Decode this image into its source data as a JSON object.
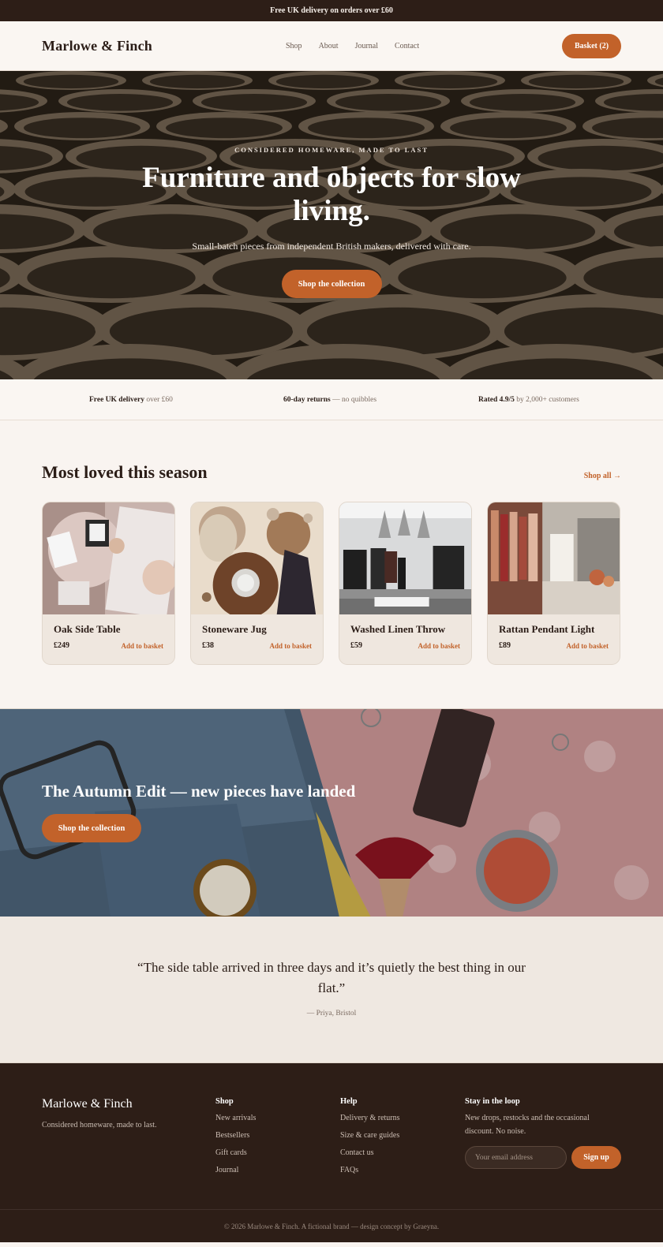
{
  "announcement": "Free UK delivery on orders over £60",
  "header": {
    "logo": "Marlowe & Finch",
    "nav": [
      "Shop",
      "About",
      "Journal",
      "Contact"
    ],
    "basket": "Basket (2)"
  },
  "hero": {
    "eyebrow": "CONSIDERED HOMEWARE, MADE TO LAST",
    "title": "Furniture and objects for slow living.",
    "subtitle": "Small-batch pieces from independent British makers, delivered with care.",
    "cta": "Shop the collection"
  },
  "trust": [
    {
      "bold": "Free UK delivery",
      "rest": " over £60"
    },
    {
      "bold": "60-day returns",
      "rest": " — no quibbles"
    },
    {
      "bold": "Rated 4.9/5",
      "rest": " by 2,000+ customers"
    }
  ],
  "products": {
    "title": "Most loved this season",
    "shop_all": "Shop all →",
    "items": [
      {
        "name": "Oak Side Table",
        "price": "£249",
        "cta": "Add to basket"
      },
      {
        "name": "Stoneware Jug",
        "price": "£38",
        "cta": "Add to basket"
      },
      {
        "name": "Washed Linen Throw",
        "price": "£59",
        "cta": "Add to basket"
      },
      {
        "name": "Rattan Pendant Light",
        "price": "£89",
        "cta": "Add to basket"
      }
    ]
  },
  "promo": {
    "title": "The Autumn Edit — new pieces have landed",
    "cta": "Shop the collection"
  },
  "testimonial": {
    "quote": "“The side table arrived in three days and it’s quietly the best thing in our flat.”",
    "author": "— Priya, Bristol"
  },
  "footer": {
    "brand": "Marlowe & Finch",
    "tagline": "Considered homeware, made to last.",
    "shop": {
      "heading": "Shop",
      "links": [
        "New arrivals",
        "Bestsellers",
        "Gift cards",
        "Journal"
      ]
    },
    "help": {
      "heading": "Help",
      "links": [
        "Delivery & returns",
        "Size & care guides",
        "Contact us",
        "FAQs"
      ]
    },
    "newsletter": {
      "heading": "Stay in the loop",
      "text": "New drops, restocks and the occasional discount. No noise.",
      "placeholder": "Your email address",
      "button": "Sign up"
    },
    "copyright": "© 2026 Marlowe & Finch. A fictional brand — design concept by Graeyna."
  },
  "colors": {
    "accent": "#c2622a",
    "dark": "#2d1e17",
    "background": "#f9f4f0"
  }
}
